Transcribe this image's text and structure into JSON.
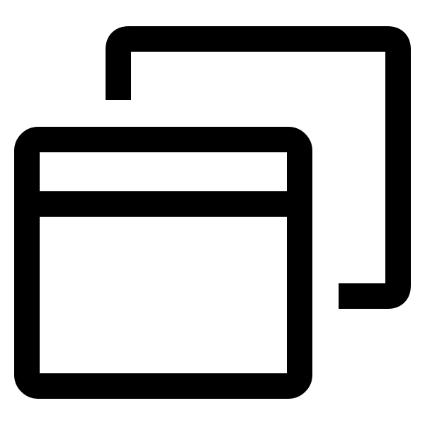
{
  "icon": {
    "name": "multiple-windows-icon",
    "color": "#000000",
    "background": "#ffffff"
  }
}
